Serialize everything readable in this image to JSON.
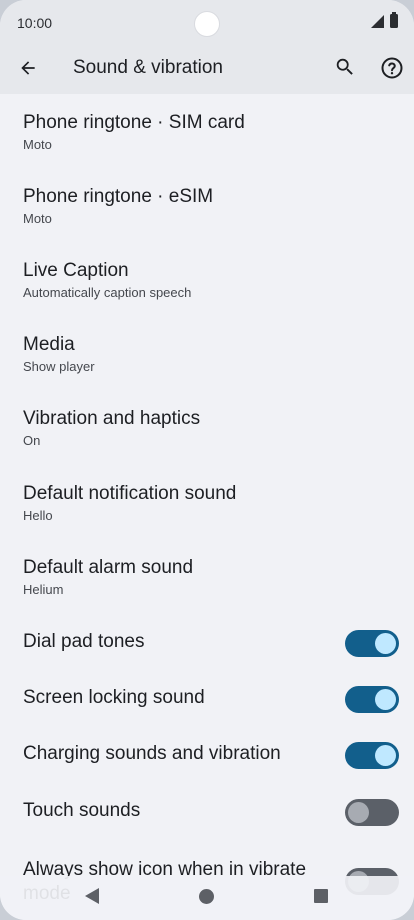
{
  "status_bar": {
    "time": "10:00"
  },
  "app_bar": {
    "title": "Sound & vibration"
  },
  "items": [
    {
      "title": "Phone ringtone · SIM card",
      "summary": "Moto"
    },
    {
      "title": "Phone ringtone · eSIM",
      "summary": "Moto"
    },
    {
      "title": "Live Caption",
      "summary": "Automatically caption speech"
    },
    {
      "title": "Media",
      "summary": "Show player"
    },
    {
      "title": "Vibration and haptics",
      "summary": "On"
    },
    {
      "title": "Default notification sound",
      "summary": "Hello"
    },
    {
      "title": "Default alarm sound",
      "summary": "Helium"
    }
  ],
  "toggles": [
    {
      "label": "Dial pad tones",
      "state": "on"
    },
    {
      "label": "Screen locking sound",
      "state": "on"
    },
    {
      "label": "Charging sounds and vibration",
      "state": "on"
    },
    {
      "label": "Touch sounds",
      "state": "off"
    },
    {
      "label": "Always show icon when in vibrate mode",
      "state": "off"
    }
  ],
  "colors": {
    "toggle_on": "#125f8c",
    "toggle_off": "#5b6068",
    "background": "#f1f2f6",
    "app_bar": "#e6e8ec"
  }
}
